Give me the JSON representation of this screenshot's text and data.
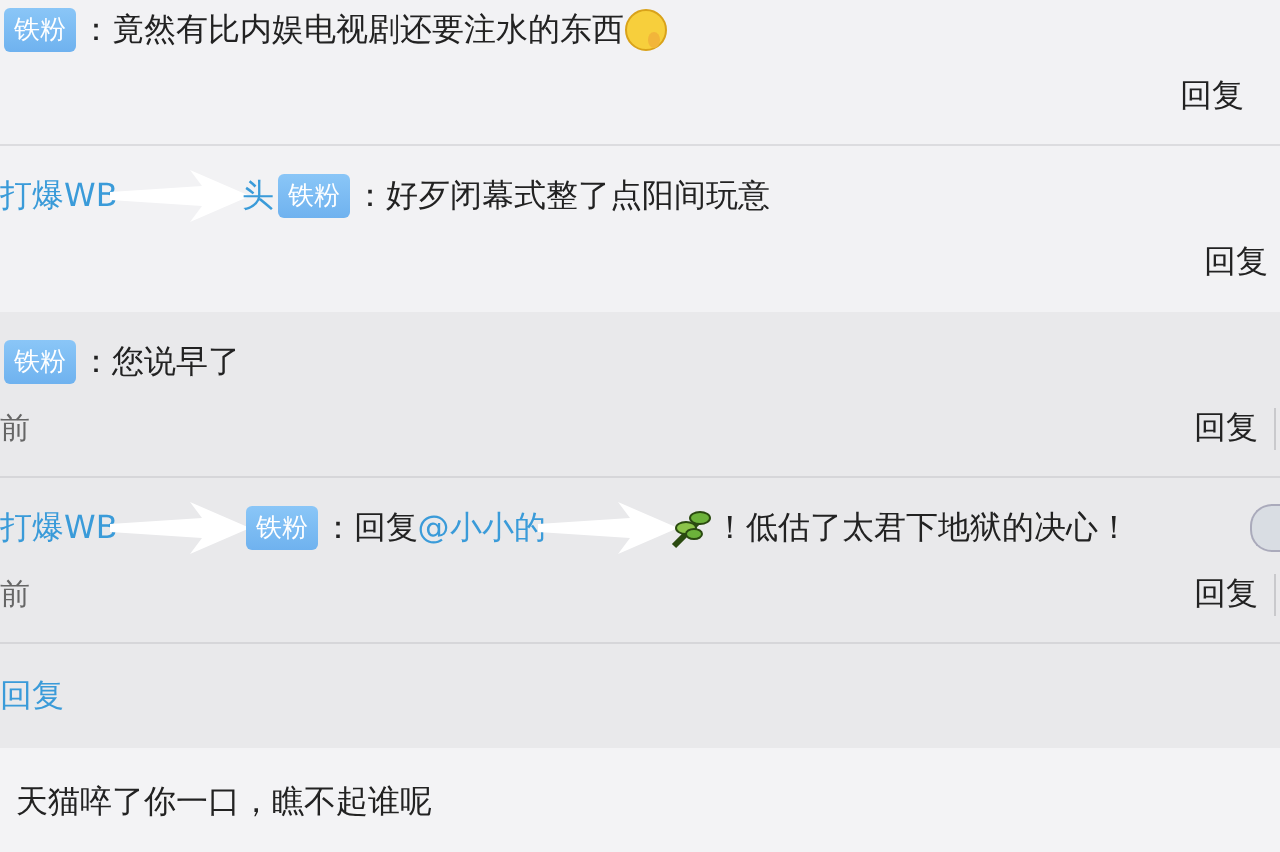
{
  "top_comments": [
    {
      "parts": [
        {
          "kind": "badge",
          "text": "铁粉"
        },
        {
          "kind": "text",
          "text": "：竟然有比内娱电视剧还要注水的东西"
        },
        {
          "kind": "face"
        }
      ],
      "action": "回复"
    },
    {
      "parts": [
        {
          "kind": "name",
          "text": "打爆WB"
        },
        {
          "kind": "arrow"
        },
        {
          "kind": "name",
          "text": "头"
        },
        {
          "kind": "badge",
          "text": "铁粉"
        },
        {
          "kind": "text",
          "text": "：好歹闭幕式整了点阳间玩意"
        }
      ],
      "action": "回复"
    }
  ],
  "sub_replies": {
    "items": [
      {
        "parts": [
          {
            "kind": "badge",
            "text": "铁粉"
          },
          {
            "kind": "text",
            "text": "：您说早了"
          }
        ],
        "time": "前",
        "action": "回复"
      },
      {
        "parts": [
          {
            "kind": "name",
            "text": "打爆WB"
          },
          {
            "kind": "arrow"
          },
          {
            "kind": "badge",
            "text": "铁粉"
          },
          {
            "kind": "text",
            "text": "：回复"
          },
          {
            "kind": "mention",
            "text": "@小小的"
          },
          {
            "kind": "arrow"
          },
          {
            "kind": "leaf"
          },
          {
            "kind": "text",
            "text": "！低估了太君下地狱的决心！"
          }
        ],
        "time": "前",
        "action": "回复"
      }
    ],
    "reply_link": "回复"
  },
  "bottom_comment": {
    "parts": [
      {
        "kind": "text",
        "text": "天猫啐了你一口，瞧不起谁呢"
      }
    ]
  }
}
